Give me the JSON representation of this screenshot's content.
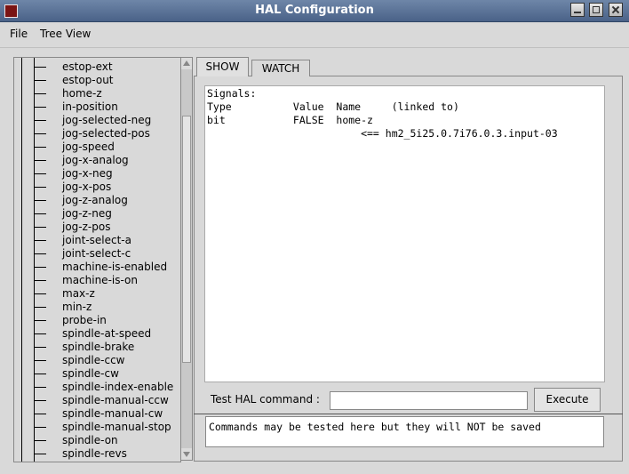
{
  "window": {
    "title": "HAL Configuration"
  },
  "menu": {
    "file": "File",
    "tree_view": "Tree View"
  },
  "tree": {
    "items": [
      "estop-ext",
      "estop-out",
      "home-z",
      "in-position",
      "jog-selected-neg",
      "jog-selected-pos",
      "jog-speed",
      "jog-x-analog",
      "jog-x-neg",
      "jog-x-pos",
      "jog-z-analog",
      "jog-z-neg",
      "jog-z-pos",
      "joint-select-a",
      "joint-select-c",
      "machine-is-enabled",
      "machine-is-on",
      "max-z",
      "min-z",
      "probe-in",
      "spindle-at-speed",
      "spindle-brake",
      "spindle-ccw",
      "spindle-cw",
      "spindle-index-enable",
      "spindle-manual-ccw",
      "spindle-manual-cw",
      "spindle-manual-stop",
      "spindle-on",
      "spindle-revs"
    ]
  },
  "tabs": {
    "show": "SHOW",
    "watch": "WATCH"
  },
  "show_text": {
    "line1": "Signals:",
    "line2": "Type          Value  Name     (linked to)",
    "line3": "bit           FALSE  home-z",
    "line4": "                         <== hm2_5i25.0.7i76.0.3.input-03"
  },
  "command": {
    "label": "Test HAL command :",
    "value": "",
    "execute": "Execute",
    "status": "Commands may be tested here but they will NOT be saved"
  }
}
